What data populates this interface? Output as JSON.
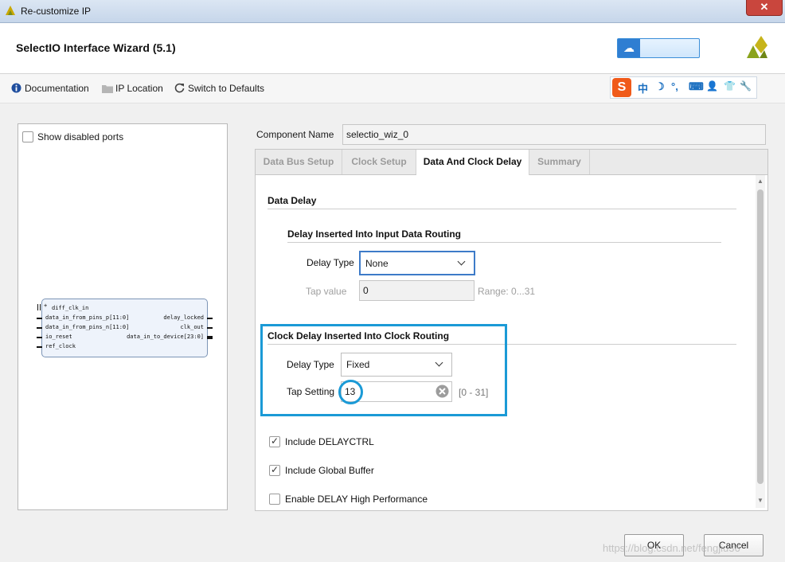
{
  "window": {
    "title": "Re-customize IP",
    "close_label": "✕"
  },
  "header": {
    "wizard_title": "SelectIO Interface Wizard (5.1)"
  },
  "toolbar": {
    "documentation": "Documentation",
    "ip_location": "IP Location",
    "switch_defaults": "Switch to Defaults",
    "ime_items": [
      "S",
      "中",
      "☽",
      "°,",
      "⌨",
      "👤",
      "👕",
      "🔧"
    ]
  },
  "left_panel": {
    "show_disabled_label": "Show disabled ports",
    "symbol": {
      "left_ports": [
        "diff_clk_in",
        "data_in_from_pins_p[11:0]",
        "data_in_from_pins_n[11:0]",
        "io_reset",
        "ref_clock"
      ],
      "right_ports": [
        "delay_locked",
        "clk_out",
        "data_in_to_device[23:0]"
      ]
    }
  },
  "component": {
    "label": "Component Name",
    "value": "selectio_wiz_0"
  },
  "tabs": [
    "Data Bus Setup",
    "Clock Setup",
    "Data And Clock Delay",
    "Summary"
  ],
  "active_tab": "Data And Clock Delay",
  "data_delay": {
    "section_title": "Data Delay",
    "subsection_title": "Delay Inserted Into Input Data Routing",
    "delay_type_label": "Delay Type",
    "delay_type_value": "None",
    "tap_value_label": "Tap value",
    "tap_value": "0",
    "tap_range": "Range: 0...31"
  },
  "clock_delay": {
    "section_title": "Clock Delay Inserted Into Clock Routing",
    "delay_type_label": "Delay Type",
    "delay_type_value": "Fixed",
    "tap_setting_label": "Tap Setting",
    "tap_setting_value": "13",
    "tap_range": "[0 - 31]"
  },
  "options": [
    {
      "label": "Include DELAYCTRL",
      "checked": true
    },
    {
      "label": "Include Global Buffer",
      "checked": true
    },
    {
      "label": "Enable DELAY High Performance",
      "checked": false
    }
  ],
  "buttons": {
    "ok": "OK",
    "cancel": "Cancel"
  },
  "watermark": "https://blog.csdn.net/fengjiu36",
  "colors": {
    "highlight": "#1b9ad6",
    "title_bar": "#c6d6ea",
    "close": "#c9463d"
  }
}
